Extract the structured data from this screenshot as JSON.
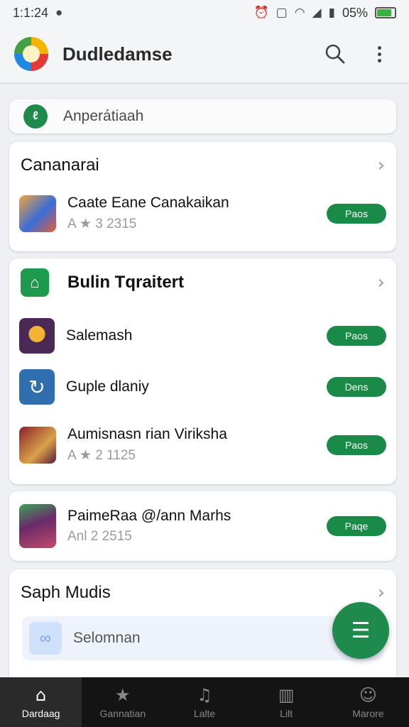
{
  "status": {
    "time": "1:1:24",
    "battery": "05%",
    "battery_fill": 0.85
  },
  "appbar": {
    "title": "Dudledamse"
  },
  "search": {
    "placeholder": "Anperátiaah"
  },
  "section1": {
    "title": "Cananarai",
    "item": {
      "title": "Caate Eane Canakaikan",
      "rating_prefix": "A",
      "rating": "3 2315",
      "action": "Paos"
    }
  },
  "section2": {
    "title": "Bulin Tqraitert",
    "items": [
      {
        "title": "Salemash",
        "action": "Paos"
      },
      {
        "title": "Guple dlaniy",
        "action": "Dens"
      },
      {
        "title": "Aumisnasn rian Viriksha",
        "rating_prefix": "A",
        "rating": "2 1125",
        "action": "Paos"
      }
    ]
  },
  "section3": {
    "item": {
      "title": "PaimeRaa @/ann Marhs",
      "subtitle": "Anl 2 2515",
      "action": "Paqe"
    }
  },
  "section4": {
    "title": "Saph Mudis",
    "item": {
      "title": "Selomnan"
    }
  },
  "bottomnav": [
    {
      "label": "Dardaag",
      "icon": "home-icon"
    },
    {
      "label": "Gannatian",
      "icon": "star-icon"
    },
    {
      "label": "Lalte",
      "icon": "bell-icon"
    },
    {
      "label": "Lilt",
      "icon": "book-icon"
    },
    {
      "label": "Marore",
      "icon": "person-icon"
    }
  ],
  "colors": {
    "accent": "#1a8a48",
    "nav_bg": "#141414"
  }
}
